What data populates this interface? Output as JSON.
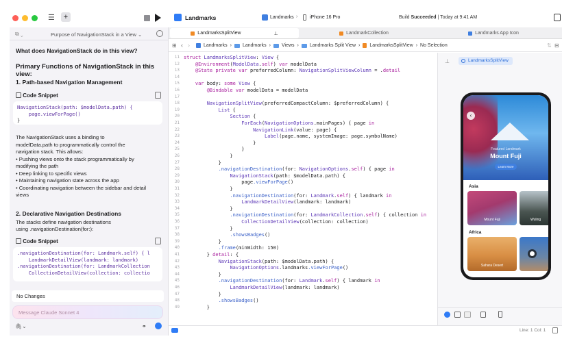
{
  "window": {
    "project_title": "Landmarks",
    "scheme": "Landmarks",
    "device": "iPhone 16 Pro",
    "build_status_prefix": "Build",
    "build_status_bold": "Succeeded",
    "build_status_time": "| Today at 9:41 AM"
  },
  "assistant": {
    "conversation_title": "Purpose of NavigationStack in a View",
    "question": "What does NavigationStack do in this view?",
    "heading": "Primary Functions of NavigationStack in this view:",
    "section1_title": "1. Path-based Navigation Management",
    "snippet_label": "Code Snippet",
    "snippet1_line1": "NavigationStack(path: $modelData.path) {",
    "snippet1_line2": "    page.viewForPage()",
    "snippet1_line3": "}",
    "para1_line1": "The NavigationStack uses a binding to",
    "para1_line2": "modelData.path to programmatically control the",
    "para1_line3": "navigation stack. This allows:",
    "bullet1_a": "• Pushing views onto the stack programmatically by",
    "bullet1_b": "modifying the path",
    "bullet2": "• Deep linking to specific views",
    "bullet3": "• Maintaining navigation state across the app",
    "bullet4_a": "• Coordinating navigation between the sidebar and detail",
    "bullet4_b": "views",
    "section2_title": "2. Declarative Navigation Destinations",
    "para2_line1": "The stacks define navigation destinations",
    "para2_line2": "using .navigationDestination(for:):",
    "snippet2_label": "Code Snippet",
    "snippet2_line1": ".navigationDestination(for: Landmark.self) { l",
    "snippet2_line2": "    LandmarkDetailView(landmark: landmark)",
    "snippet2_line3": ".navigationDestination(for: LandmarkCollection",
    "snippet2_line4": "    CollectionDetailView(collection: collectio",
    "no_changes": "No Changes",
    "message_placeholder": "Message Claude Sonnet 4"
  },
  "tabs": [
    {
      "label": "LandmarksSplitView"
    },
    {
      "label": "LandmarkCollection"
    },
    {
      "label": "Landmarks App Icon"
    }
  ],
  "jumpbar": [
    "Landmarks",
    "Landmarks",
    "Views",
    "Landmarks Split View",
    "LandmarksSplitView",
    "No Selection"
  ],
  "code": [
    {
      "n": "11",
      "t": "struct LandmarksSplitView: View {"
    },
    {
      "n": "12",
      "t": "    @Environment(ModelData.self) var modelData"
    },
    {
      "n": "13",
      "t": "    @State private var preferredColumn: NavigationSplitViewColumn = .detail"
    },
    {
      "n": "14",
      "t": ""
    },
    {
      "n": "15",
      "t": "    var body: some View {"
    },
    {
      "n": "16",
      "t": "        @Bindable var modelData = modelData"
    },
    {
      "n": "17",
      "t": ""
    },
    {
      "n": "18",
      "t": "        NavigationSplitView(preferredCompactColumn: $preferredColumn) {"
    },
    {
      "n": "19",
      "t": "            List {"
    },
    {
      "n": "20",
      "t": "                Section {"
    },
    {
      "n": "21",
      "t": "                    ForEach(NavigationOptions.mainPages) { page in"
    },
    {
      "n": "22",
      "t": "                        NavigationLink(value: page) {"
    },
    {
      "n": "23",
      "t": "                            Label(page.name, systemImage: page.symbolName)"
    },
    {
      "n": "24",
      "t": "                        }"
    },
    {
      "n": "25",
      "t": "                    }"
    },
    {
      "n": "26",
      "t": "                }"
    },
    {
      "n": "27",
      "t": "            }"
    },
    {
      "n": "28",
      "t": "            .navigationDestination(for: NavigationOptions.self) { page in"
    },
    {
      "n": "29",
      "t": "                NavigationStack(path: $modelData.path) {"
    },
    {
      "n": "30",
      "t": "                    page.viewForPage()"
    },
    {
      "n": "31",
      "t": "                }"
    },
    {
      "n": "32",
      "t": "                .navigationDestination(for: Landmark.self) { landmark in"
    },
    {
      "n": "33",
      "t": "                    LandmarkDetailView(landmark: landmark)"
    },
    {
      "n": "34",
      "t": "                }"
    },
    {
      "n": "35",
      "t": "                .navigationDestination(for: LandmarkCollection.self) { collection in"
    },
    {
      "n": "36",
      "t": "                    CollectionDetailView(collection: collection)"
    },
    {
      "n": "37",
      "t": "                }"
    },
    {
      "n": "38",
      "t": "                .showsBadges()"
    },
    {
      "n": "39",
      "t": "            }"
    },
    {
      "n": "40",
      "t": "            .frame(minWidth: 150)"
    },
    {
      "n": "41",
      "t": "        } detail: {"
    },
    {
      "n": "42",
      "t": "            NavigationStack(path: $modelData.path) {"
    },
    {
      "n": "43",
      "t": "                NavigationOptions.landmarks.viewForPage()"
    },
    {
      "n": "44",
      "t": "            }"
    },
    {
      "n": "45",
      "t": "            .navigationDestination(for: Landmark.self) { landmark in"
    },
    {
      "n": "46",
      "t": "                LandmarkDetailView(landmark: landmark)"
    },
    {
      "n": "47",
      "t": "            }"
    },
    {
      "n": "48",
      "t": "            .showsBadges()"
    },
    {
      "n": "49",
      "t": "        }"
    }
  ],
  "preview": {
    "badge": "LandmarksSplitView",
    "featured_label": "Featured Landmark",
    "featured_title": "Mount Fuji",
    "learn_more": "Learn More",
    "section_asia": "Asia",
    "card_fuji": "Mount Fuji",
    "card_wuling": "Wuling",
    "section_africa": "Africa",
    "card_sahara": "Sahara Desert"
  },
  "status": {
    "position": "Line: 1  Col: 1"
  },
  "colors": {
    "accent": "#2f7cf6",
    "keyword": "#a9219e",
    "type": "#5b36b6",
    "traffic_red": "#fe5f57",
    "traffic_yellow": "#febc2e",
    "traffic_green": "#28c840"
  }
}
